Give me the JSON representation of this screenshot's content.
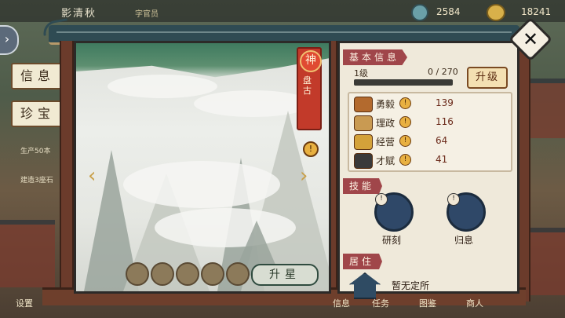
{
  "topbar": {
    "player_name": "影清秋",
    "role": "字官员",
    "coins": "2584",
    "ingots": "18241"
  },
  "sidetabs": {
    "info": "信息",
    "treasure": "珍宝",
    "task1": "生产50本",
    "task2": "建造3座石"
  },
  "portrait": {
    "rank_seal": "神",
    "rank_name": "盘古",
    "rank_info": "!",
    "left_arrow": "‹",
    "right_arrow": "›",
    "star_count": 5,
    "upgrade_star": "升星"
  },
  "info": {
    "basic_header": "基本信息",
    "level": "1级",
    "exp": "0 / 270",
    "exp_fraction": 0,
    "level_up": "升级",
    "stats": [
      {
        "label": "勇毅",
        "value": "139",
        "icon": "sword-icon"
      },
      {
        "label": "理政",
        "value": "116",
        "icon": "scroll-icon"
      },
      {
        "label": "经营",
        "value": "64",
        "icon": "abacus-icon"
      },
      {
        "label": "才赋",
        "value": "41",
        "icon": "fan-icon"
      }
    ],
    "skills_header": "技能",
    "skills": [
      {
        "name": "研刻",
        "icon": "skill-rabbit-icon"
      },
      {
        "name": "归息",
        "icon": "skill-bird-icon"
      }
    ],
    "residence_header": "居住",
    "residence": "暂无定所",
    "info_marker": "!"
  },
  "close_label": "✕",
  "base_labels": [
    "设置",
    "信息",
    "任务",
    "图鉴",
    "商人"
  ]
}
